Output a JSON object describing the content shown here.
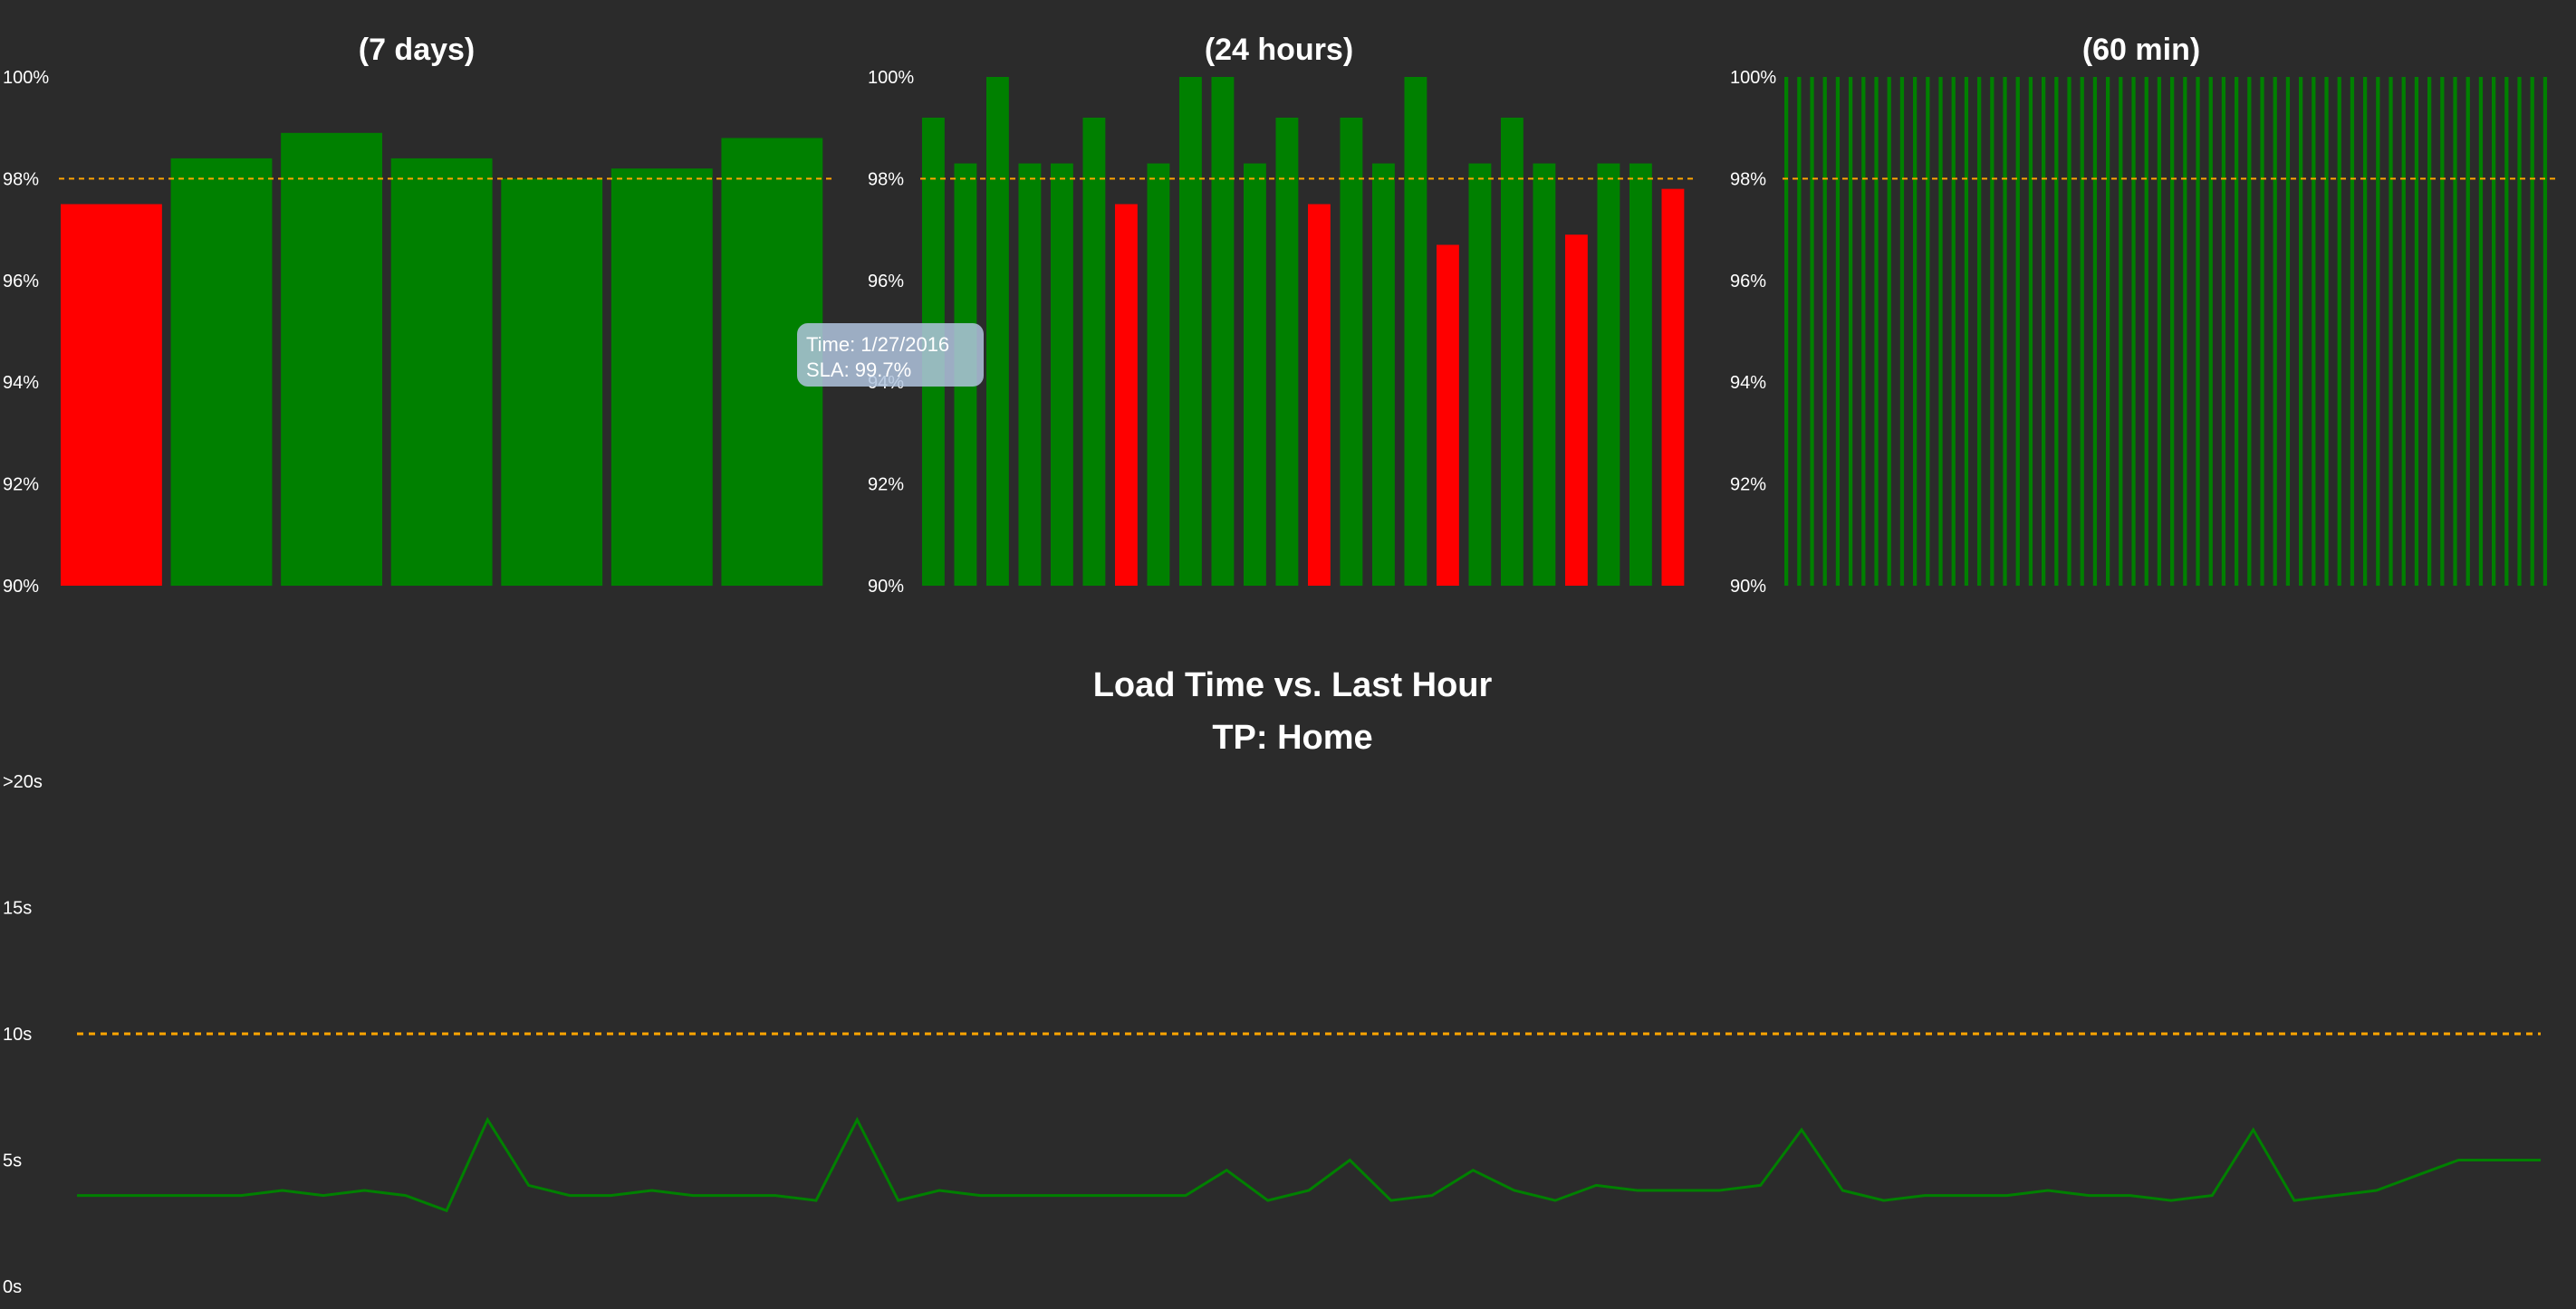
{
  "theme": {
    "background": "#2b2b2b",
    "good": "#008000",
    "bad": "#ff0000",
    "threshold": "#ffa500",
    "text": "#ffffff"
  },
  "tooltip": {
    "time_label": "Time: 1/27/2016",
    "sla_label": "SLA: 99.7%"
  },
  "chart_data": [
    {
      "type": "bar",
      "title": "(7 days)",
      "ylim": [
        90,
        100
      ],
      "yticks": [
        "90%",
        "92%",
        "94%",
        "96%",
        "98%",
        "100%"
      ],
      "ytick_values": [
        90,
        92,
        94,
        96,
        98,
        100
      ],
      "threshold": 98,
      "values": [
        97.5,
        98.4,
        98.9,
        98.4,
        98.0,
        98.2,
        98.8
      ],
      "status": [
        "bad",
        "good",
        "good",
        "good",
        "good",
        "good",
        "good"
      ]
    },
    {
      "type": "bar",
      "title": "(24 hours)",
      "ylim": [
        90,
        100
      ],
      "yticks": [
        "90%",
        "92%",
        "94%",
        "96%",
        "98%",
        "100%"
      ],
      "ytick_values": [
        90,
        92,
        94,
        96,
        98,
        100
      ],
      "threshold": 98,
      "values": [
        99.2,
        98.3,
        100,
        98.3,
        98.3,
        99.2,
        97.5,
        98.3,
        100,
        100,
        98.3,
        99.2,
        97.5,
        99.2,
        98.3,
        100,
        96.7,
        98.3,
        99.2,
        98.3,
        96.9,
        98.3,
        98.3,
        97.8
      ],
      "status": [
        "good",
        "good",
        "good",
        "good",
        "good",
        "good",
        "bad",
        "good",
        "good",
        "good",
        "good",
        "good",
        "bad",
        "good",
        "good",
        "good",
        "bad",
        "good",
        "good",
        "good",
        "bad",
        "good",
        "good",
        "bad"
      ]
    },
    {
      "type": "bar",
      "title": "(60 min)",
      "ylim": [
        90,
        100
      ],
      "yticks": [
        "90%",
        "92%",
        "94%",
        "96%",
        "98%",
        "100%"
      ],
      "ytick_values": [
        90,
        92,
        94,
        96,
        98,
        100
      ],
      "threshold": 98,
      "values": [
        100,
        100,
        100,
        100,
        100,
        100,
        100,
        100,
        100,
        100,
        100,
        100,
        100,
        100,
        100,
        100,
        100,
        100,
        100,
        100,
        100,
        100,
        100,
        100,
        100,
        100,
        100,
        100,
        100,
        100,
        100,
        100,
        100,
        100,
        100,
        100,
        100,
        100,
        100,
        100,
        100,
        100,
        100,
        100,
        100,
        100,
        100,
        100,
        100,
        100,
        100,
        100,
        100,
        100,
        100,
        100,
        100,
        100,
        100,
        100
      ],
      "status": [
        "good",
        "good",
        "good",
        "good",
        "good",
        "good",
        "good",
        "good",
        "good",
        "good",
        "good",
        "good",
        "good",
        "good",
        "good",
        "good",
        "good",
        "good",
        "good",
        "good",
        "good",
        "good",
        "good",
        "good",
        "good",
        "good",
        "good",
        "good",
        "good",
        "good",
        "good",
        "good",
        "good",
        "good",
        "good",
        "good",
        "good",
        "good",
        "good",
        "good",
        "good",
        "good",
        "good",
        "good",
        "good",
        "good",
        "good",
        "good",
        "good",
        "good",
        "good",
        "good",
        "good",
        "good",
        "good",
        "good",
        "good",
        "good",
        "good",
        "good"
      ]
    },
    {
      "type": "line",
      "title": "Load Time vs. Last Hour",
      "subtitle": "TP: Home",
      "ylim": [
        0,
        20
      ],
      "yticks": [
        "0s",
        "5s",
        "10s",
        "15s",
        ">20s"
      ],
      "ytick_values": [
        0,
        5,
        10,
        15,
        20
      ],
      "threshold": 10,
      "values": [
        3.6,
        3.6,
        3.6,
        3.6,
        3.6,
        3.8,
        3.6,
        3.8,
        3.6,
        3.0,
        6.6,
        4.0,
        3.6,
        3.6,
        3.8,
        3.6,
        3.6,
        3.6,
        3.4,
        6.6,
        3.4,
        3.8,
        3.6,
        3.6,
        3.6,
        3.6,
        3.6,
        3.6,
        4.6,
        3.4,
        3.8,
        5.0,
        3.4,
        3.6,
        4.6,
        3.8,
        3.4,
        4.0,
        3.8,
        3.8,
        3.8,
        4.0,
        6.2,
        3.8,
        3.4,
        3.6,
        3.6,
        3.6,
        3.8,
        3.6,
        3.6,
        3.4,
        3.6,
        6.2,
        3.4,
        3.6,
        3.8,
        4.4,
        5.0,
        5.0,
        5.0
      ]
    }
  ]
}
